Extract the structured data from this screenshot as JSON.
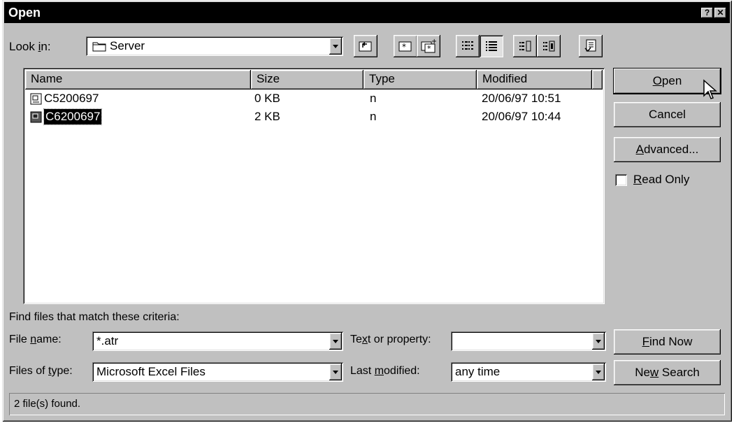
{
  "window": {
    "title": "Open",
    "help_label": "?",
    "close_label": "✕"
  },
  "lookin": {
    "label_pre": "Look ",
    "label_key": "i",
    "label_post": "n:",
    "value": "Server"
  },
  "toolbar": {
    "icons": [
      "up-one-level-icon",
      "search-web-icon",
      "add-to-favorites-icon",
      "list-view-icon",
      "details-view-icon",
      "properties-view-icon",
      "preview-view-icon",
      "commands-settings-icon"
    ]
  },
  "list": {
    "columns": [
      "Name",
      "Size",
      "Type",
      "Modified"
    ],
    "rows": [
      {
        "name": "C5200697",
        "size": "0 KB",
        "type": "n",
        "modified": "20/06/97 10:51"
      },
      {
        "name": "C6200697",
        "size": "2 KB",
        "type": "n",
        "modified": "20/06/97 10:44"
      }
    ]
  },
  "buttons": {
    "open": {
      "key": "O",
      "rest": "pen"
    },
    "cancel": "Cancel",
    "advanced": {
      "key": "A",
      "rest": "dvanced..."
    },
    "readonly": {
      "key": "R",
      "rest": "ead Only"
    },
    "findnow": {
      "key": "F",
      "rest": "ind Now"
    },
    "newsearch": {
      "pre": "Ne",
      "key": "w",
      "rest": " Search"
    }
  },
  "criteria": {
    "heading": "Find files that match these criteria:",
    "filename": {
      "pre": "File ",
      "key": "n",
      "post": "ame:",
      "value": "*.atr"
    },
    "filetype": {
      "pre": "Files of ",
      "key": "t",
      "post": "ype:",
      "value": "Microsoft Excel Files"
    },
    "textprop": {
      "pre": "Te",
      "key": "x",
      "post": "t or property:",
      "value": ""
    },
    "lastmod": {
      "pre": "Last ",
      "key": "m",
      "post": "odified:",
      "value": "any time"
    }
  },
  "status": "2 file(s) found."
}
